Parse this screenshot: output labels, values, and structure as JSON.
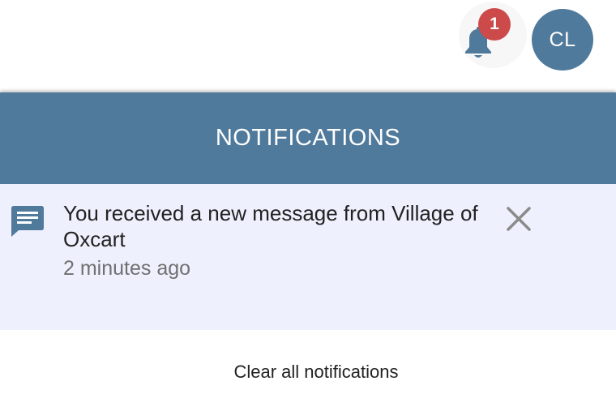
{
  "header": {
    "notification_count": "1",
    "avatar_initials": "CL"
  },
  "panel": {
    "title": "NOTIFICATIONS",
    "notifications": [
      {
        "message": "You received a new message from Village of Oxcart",
        "time": "2 minutes ago",
        "icon": "message-icon"
      }
    ],
    "clear_all_label": "Clear all notifications"
  },
  "colors": {
    "primary": "#507a9c",
    "badge": "#cd4a4a",
    "notification_bg": "#eef0fd"
  }
}
